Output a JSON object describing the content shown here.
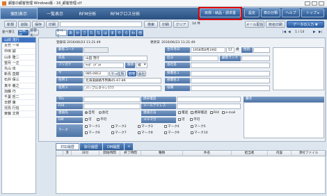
{
  "window": {
    "title": "顧客の顧客管理 Windows版 - 16_顧客管理.clf"
  },
  "nav": {
    "tabs": [
      "個別表示",
      "一覧表示",
      "RFM分析",
      "RFMクロス分析"
    ],
    "buttons": [
      "目標・納品・請求書",
      "設定",
      "表の分類",
      "ヘルプ",
      "トップ ▸"
    ]
  },
  "toolbar": {
    "left": [
      "新規",
      "削除",
      "保存",
      "印刷"
    ],
    "search": "検索",
    "print": "印刷",
    "clear": "クリア",
    "count": "14 件",
    "right": [
      "メール配信",
      "宛名印刷",
      "データの入力 ▼"
    ],
    "page": "1 / 14"
  },
  "list": {
    "header": [
      "並べ替え",
      "登録日",
      "並替え"
    ],
    "names": [
      "山田 茂行",
      "大竹 一平",
      "中田 誠",
      "山本 隆二",
      "望月 一正",
      "丸山 出",
      "新島 直樹",
      "石井 保三",
      "真中 義之",
      "加藤 巧",
      "千葉 哲二",
      "日野 肇",
      "児島 行信",
      "斉藤 文男"
    ]
  },
  "kana": [
    "すべて",
    "あ",
    "か",
    "さ",
    "た",
    "な",
    "は",
    "ま",
    "や",
    "ら",
    "わ",
    "他"
  ],
  "form": {
    "reg_label": "登録日",
    "reg_value": "2016/06/23 11:21:49",
    "upd_label": "更新日",
    "upd_value": "2016/06/23 11:21:49",
    "code_label": "顧客コード",
    "name_label": "氏名",
    "name_value": "山田 茂行",
    "furi_label": "フリガナ",
    "furi_value": "ﾔﾏﾀﾞ ｼｹﾞﾕｷ",
    "title_label": "敬称",
    "title_value": "様",
    "zip_label": "〒",
    "zip_value": "085-0812",
    "zip_btn": "〒→住所",
    "addr_btn1": "自宅",
    "addr_btn2": "会社",
    "addr1_label": "住所１",
    "addr1_value": "北海道釧路市幣舞45-67-89",
    "addr2_label": "住所２",
    "addr2_value": "パープルタウン777",
    "birth_label": "生年月日",
    "birth_value": "1958年8月19日",
    "age_value": "57",
    "age_unit": "歳",
    "sex_label": "性別",
    "div_label": "区分",
    "rank_label": "顧客ランク",
    "company_label": "会社名",
    "dept1_label": "部署名１",
    "dept2_label": "部署名２",
    "post_label": "役職",
    "tel_label": "TEL",
    "mobile_label": "携帯電話",
    "fax_label": "FAX",
    "mail_label": "メールアドレス",
    "contact_label": "連絡先",
    "contact_home": "自宅",
    "contact_company": "会社",
    "method_label": "連絡方法",
    "method_opts": [
      "電話",
      "携帯電話",
      "FAX",
      "e-mail"
    ],
    "dm_label": "DM",
    "dm_opts": [
      "可",
      "不可"
    ],
    "mailmag_label": "メルマガ",
    "mailmag_opts": [
      "可",
      "不可"
    ],
    "mark_label": "マーク",
    "marks": [
      "マーク1",
      "マーク2",
      "マーク3",
      "マーク4",
      "マーク5",
      "マーク6",
      "マーク7",
      "マーク8",
      "マーク9",
      "マーク10"
    ],
    "note_label": "備考"
  },
  "bottom": {
    "tabs": [
      "対応履歴",
      "取引履歴",
      "DM履歴"
    ],
    "plus": "+",
    "cols": [
      "済",
      "日付",
      "開始時間",
      "終了時間",
      "種類",
      "件名",
      "担当者",
      "内容",
      "添付ファイル"
    ]
  }
}
